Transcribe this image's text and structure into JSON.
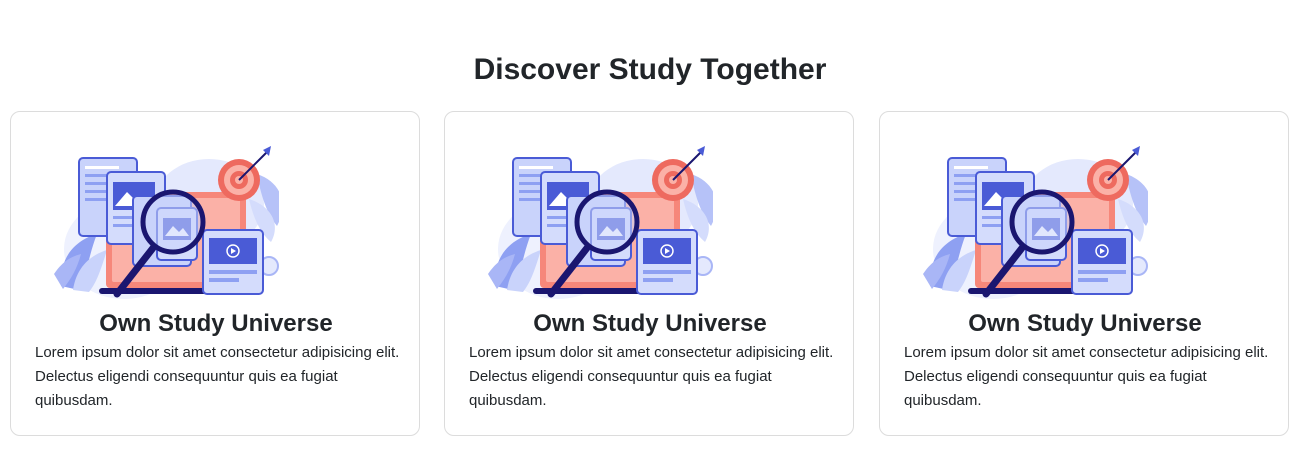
{
  "section": {
    "title": "Discover Study Together"
  },
  "cards": [
    {
      "icon": "study-research-illustration",
      "title": "Own Study Universe",
      "text": "Lorem ipsum dolor sit amet consectetur adipisicing elit. Delectus eligendi consequuntur quis ea fugiat quibusdam."
    },
    {
      "icon": "study-research-illustration",
      "title": "Own Study Universe",
      "text": "Lorem ipsum dolor sit amet consectetur adipisicing elit. Delectus eligendi consequuntur quis ea fugiat quibusdam."
    },
    {
      "icon": "study-research-illustration",
      "title": "Own Study Universe",
      "text": "Lorem ipsum dolor sit amet consectetur adipisicing elit. Delectus eligendi consequuntur quis ea fugiat quibusdam."
    }
  ],
  "colors": {
    "primary_blue": "#4a5bd6",
    "light_blue": "#c9d3fb",
    "pale_blue": "#e4e9fd",
    "navy": "#1a1670",
    "salmon": "#f6877a",
    "target_red": "#ee6a5f"
  }
}
